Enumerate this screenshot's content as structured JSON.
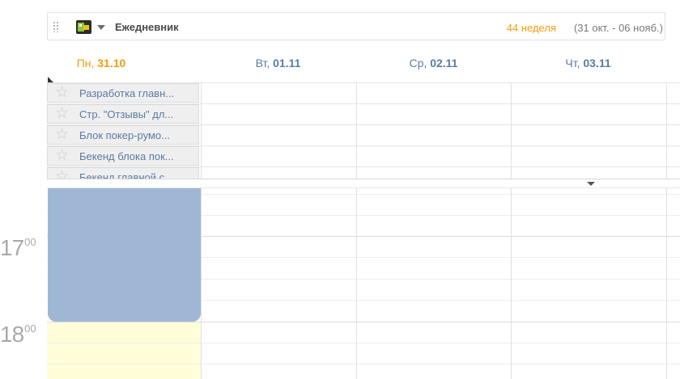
{
  "header": {
    "app_title": "Ежедневник",
    "week_label": "44 неделя",
    "week_range": "(31 окт. - 06 нояб.)"
  },
  "days": [
    {
      "name": "Пн,",
      "date": "31.10",
      "today": true
    },
    {
      "name": "Вт,",
      "date": "01.11",
      "today": false
    },
    {
      "name": "Ср,",
      "date": "02.11",
      "today": false
    },
    {
      "name": "Чт,",
      "date": "03.11",
      "today": false
    }
  ],
  "tasks": [
    {
      "label": "Разработка главн..."
    },
    {
      "label": "Стр. \"Отзывы\" дл..."
    },
    {
      "label": "Блок покер-румо..."
    },
    {
      "label": "Бекенд блока пок..."
    },
    {
      "label": "Бекенд главной с..."
    }
  ],
  "hours": [
    {
      "hour": "17",
      "minutes": "00"
    },
    {
      "hour": "18",
      "minutes": "00"
    }
  ],
  "colors": {
    "accent_orange": "#f39c12",
    "day_blue": "#5b7ba3",
    "event_block": "#9fb7d5",
    "work_hours_bg": "#fffed8"
  },
  "icons": {
    "app": "calendar-app-icon",
    "handle": "drag-handle-icon",
    "favorite": "star-icon",
    "expand": "caret-down-icon"
  }
}
